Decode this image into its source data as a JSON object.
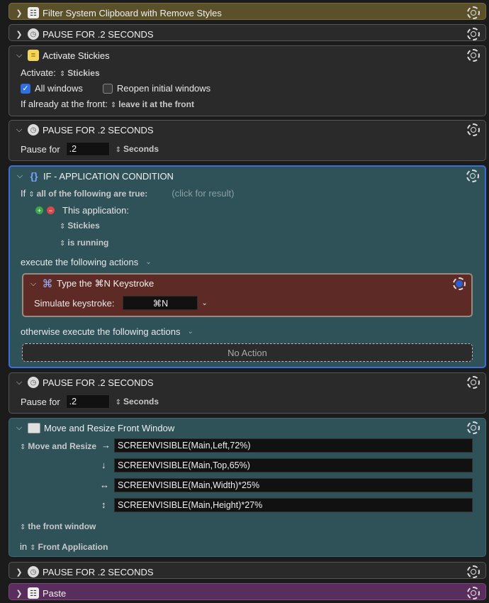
{
  "blocks": {
    "filter": {
      "title": "Filter System Clipboard with Remove Styles"
    },
    "pause1": {
      "title": "PAUSE FOR .2 SECONDS"
    },
    "activate": {
      "title": "Activate Stickies",
      "activate_label": "Activate:",
      "app": "Stickies",
      "all_windows": "All windows",
      "reopen": "Reopen initial windows",
      "front_label": "If already at the front:",
      "front_value": "leave it at the front"
    },
    "pause2": {
      "title": "PAUSE FOR .2 SECONDS",
      "pause_label": "Pause for",
      "value": ".2",
      "unit": "Seconds"
    },
    "if": {
      "title": "IF - APPLICATION CONDITION",
      "if_label": "If",
      "condition": "all of the following are true:",
      "result_hint": "(click for result)",
      "this_app": "This application:",
      "app": "Stickies",
      "state": "is running",
      "execute": "execute the following actions",
      "otherwise": "otherwise execute the following actions",
      "no_action": "No Action"
    },
    "keystroke": {
      "title": "Type the ⌘N Keystroke",
      "simulate_label": "Simulate keystroke:",
      "value": "⌘N"
    },
    "pause3": {
      "title": "PAUSE FOR .2 SECONDS",
      "pause_label": "Pause for",
      "value": ".2",
      "unit": "Seconds"
    },
    "move": {
      "title": "Move and Resize Front Window",
      "mode": "Move and Resize",
      "left": "SCREENVISIBLE(Main,Left,72%)",
      "top": "SCREENVISIBLE(Main,Top,65%)",
      "width": "SCREENVISIBLE(Main,Width)*25%",
      "height": "SCREENVISIBLE(Main,Height)*27%",
      "window": "the front window",
      "in_label": "in",
      "app": "Front Application"
    },
    "pause4": {
      "title": "PAUSE FOR .2 SECONDS"
    },
    "paste": {
      "title": "Paste"
    }
  },
  "icons": [
    "chevron-right-icon",
    "chevron-down-icon",
    "clock-icon",
    "gear-icon",
    "clipboard-icon",
    "stickies-icon",
    "braces-icon",
    "command-icon",
    "window-icon",
    "checkbox-icon"
  ],
  "colors": {
    "filter_bg": "#5a5029",
    "teal_bg": "#2f5259",
    "paste_bg": "#5a2e5c",
    "keystroke_bg": "#5e2a25",
    "selection": "#3a6fd8"
  }
}
